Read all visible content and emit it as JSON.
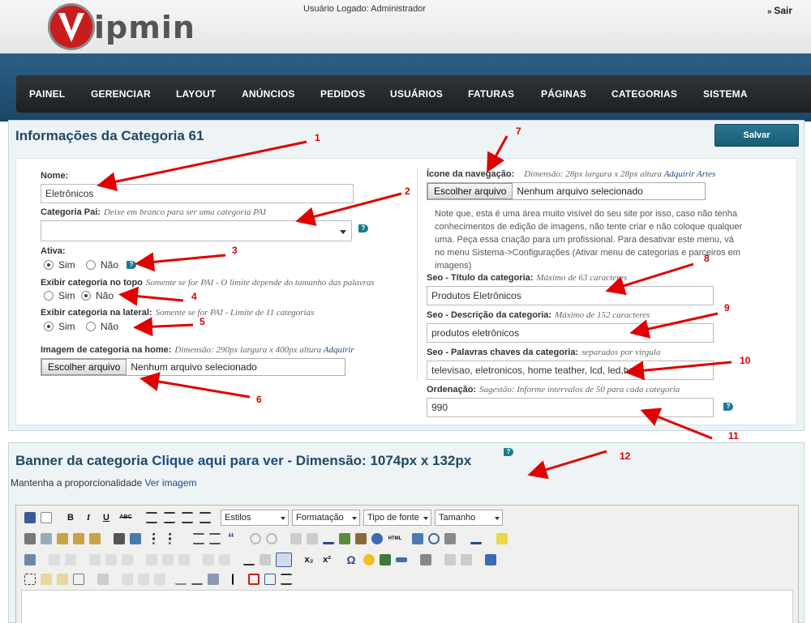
{
  "header": {
    "logo_text": "Vipmin",
    "logo_text_rest": "ipmin",
    "user_label": "Usuário Logado: Administrador",
    "logout_label": "Sair",
    "colors": {
      "brand_red": "#c61e1e",
      "nav_bg": "#25292b",
      "band": "#245277",
      "accent": "#1e4a63"
    }
  },
  "nav": [
    "PAINEL",
    "GERENCIAR",
    "LAYOUT",
    "ANÚNCIOS",
    "PEDIDOS",
    "USUÁRIOS",
    "FATURAS",
    "PÁGINAS",
    "CATEGORIAS",
    "SISTEMA"
  ],
  "category_panel": {
    "title": "Informações da Categoria 61",
    "save_label": "Salvar",
    "nome": {
      "label": "Nome:",
      "value": "Eletrônicos"
    },
    "categoria_pai": {
      "label": "Categoria Pai:",
      "hint": "Deixe em branco para ser uma categoria PAI",
      "value": ""
    },
    "ativa": {
      "label": "Ativa:",
      "options": [
        "Sim",
        "Não"
      ],
      "selected": "Sim"
    },
    "exibir_topo": {
      "label": "Exibir categoria no topo",
      "hint": "Somente se for PAI - O limite depende do tamanho das palavras",
      "options": [
        "Sim",
        "Não"
      ],
      "selected": "Não"
    },
    "exibir_lateral": {
      "label": "Exibir categoria na lateral:",
      "hint": "Somente se for PAI - Limite de 11 categorias",
      "options": [
        "Sim",
        "Não"
      ],
      "selected": "Sim"
    },
    "imagem": {
      "label": "Imagem de categoria na home:",
      "hint": "Dimensão: 290px largura x 400px altura",
      "link": "Adquirir",
      "button": "Escolher arquivo",
      "file_status": "Nenhum arquivo selecionado"
    },
    "icone": {
      "label": "Ícone da navegação:",
      "hint": "Dimensão: 28px largura x 28px altura",
      "link": "Adquirir Artes",
      "button": "Escolher arquivo",
      "file_status": "Nenhum arquivo selecionado"
    },
    "note": "Note que, esta é uma área muito visível do seu site por isso, caso não tenha conhecimentos de edição de imagens, não tente criar e não coloque qualquer uma. Peça essa criação para um profissional. Para desativar este menu, vá no menu Sistema->Configurações (Ativar menu de categorias e parceiros em imagens)",
    "seo_titulo": {
      "label": "Seo - Título da categoria:",
      "hint": "Máximo de 63 caracteres",
      "value": "Produtos Eletrônicos"
    },
    "seo_descricao": {
      "label": "Seo - Descrição da categoria:",
      "hint": "Máximo de 152 caracteres",
      "value": "produtos eletrônicos"
    },
    "seo_palavras": {
      "label": "Seo - Palavras chaves da categoria:",
      "hint": "separados por virgula",
      "value": "televisao, eletronicos, home teather, lcd, led,tv"
    },
    "ordenacao": {
      "label": "Ordenação:",
      "hint": "Sugestão: Informe intervalos de 50 para cada categoria",
      "value": "990"
    }
  },
  "banner_panel": {
    "title_prefix": "Banner da categoria",
    "title_link": "Clique aqui para ver",
    "title_suffix": "- Dimensão: 1074px x 132px",
    "keep_text": "Mantenha a proporcionalidade",
    "keep_link": "Ver imagem"
  },
  "editor": {
    "dropdowns": [
      "Estilos",
      "Formatação",
      "Tipo de fonte",
      "Tamanho"
    ],
    "toolbar_text": {
      "bold": "B",
      "italic": "I",
      "underline": "U",
      "strike": "ABC",
      "omega": "Ω",
      "sub": "x₂",
      "sup": "x²",
      "quote": "“",
      "html": "HTML"
    }
  },
  "annotations": [
    "1",
    "2",
    "3",
    "4",
    "5",
    "6",
    "7",
    "8",
    "9",
    "10",
    "11",
    "12"
  ]
}
